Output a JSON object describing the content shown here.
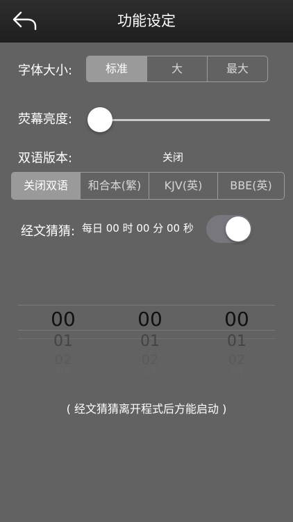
{
  "nav": {
    "title": "功能设定",
    "back_icon": "back-arrow-icon"
  },
  "font_size": {
    "label": "字体大小:",
    "options": [
      "标准",
      "大",
      "最大"
    ],
    "selected": "标准"
  },
  "brightness": {
    "label": "荧幕亮度:",
    "level": 0.0
  },
  "bilingual": {
    "label": "双语版本:",
    "current": "关闭",
    "options": [
      "关闭双语",
      "和合本(繁)",
      "KJV(英)",
      "BBE(英)"
    ],
    "selected": "关闭双语"
  },
  "guess": {
    "label": "经文猜猜:",
    "schedule": "每日 00 时 00 分 00 秒",
    "enabled": true
  },
  "picker": {
    "hours": [
      "00",
      "01",
      "02",
      "03"
    ],
    "minutes": [
      "00",
      "01",
      "02",
      "03"
    ],
    "seconds": [
      "00",
      "01",
      "02",
      "03"
    ]
  },
  "note": "( 经文猜猜离开程式后方能启动 )"
}
